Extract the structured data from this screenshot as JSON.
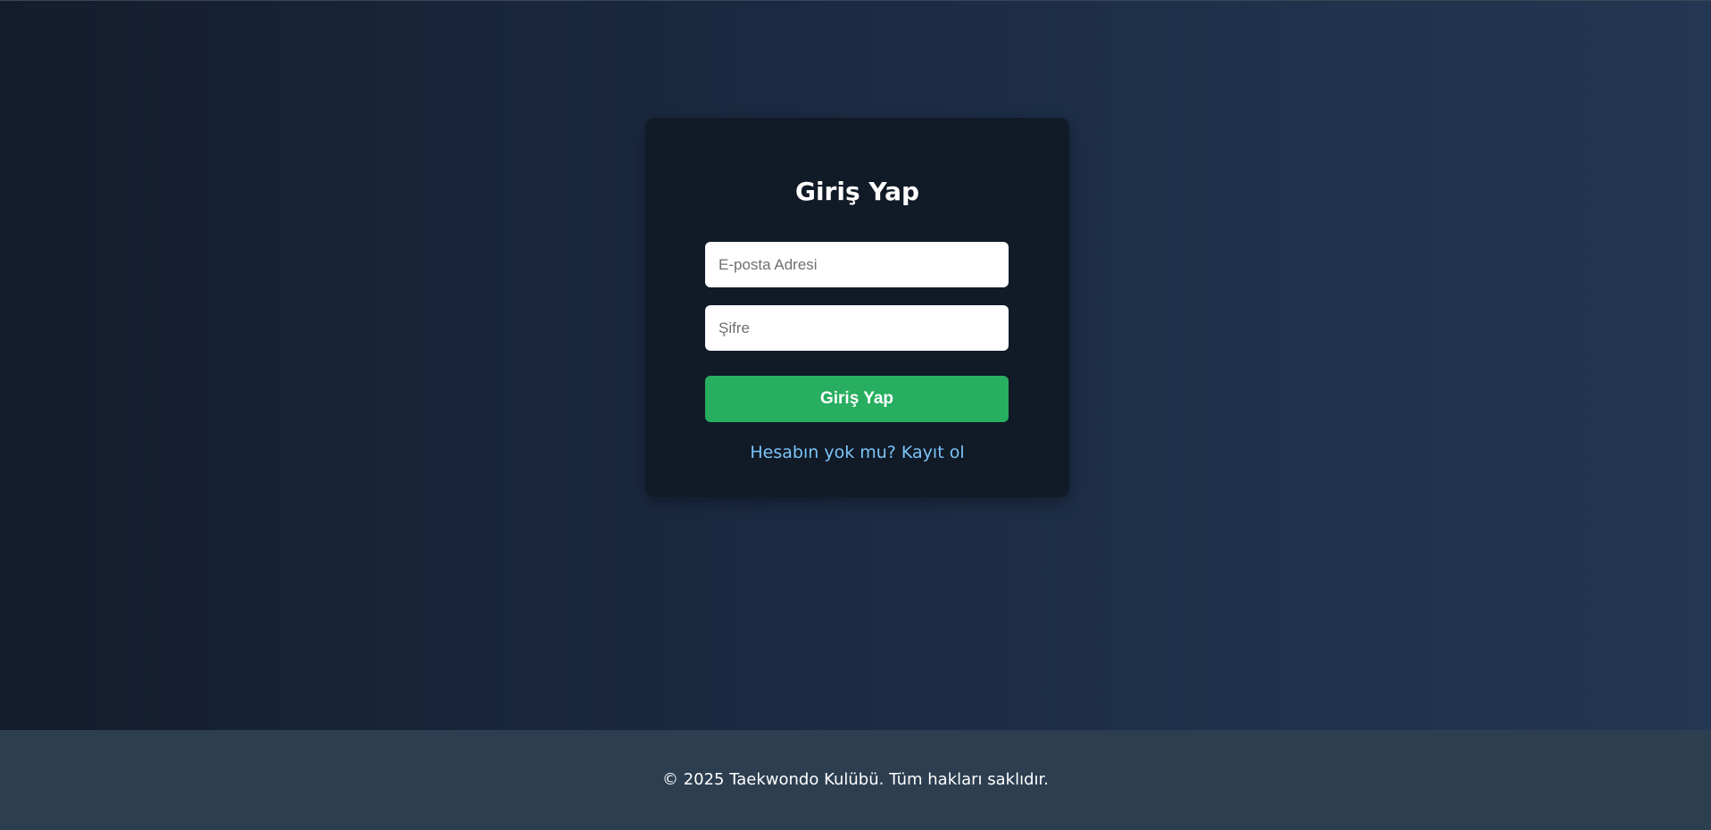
{
  "login": {
    "title": "Giriş Yap",
    "email_placeholder": "E-posta Adresi",
    "email_value": "",
    "password_placeholder": "Şifre",
    "password_value": "",
    "submit_label": "Giriş Yap",
    "register_link_text": "Hesabın yok mu? Kayıt ol"
  },
  "footer": {
    "copyright": "© 2025 Taekwondo Kulübü. Tüm hakları saklıdır."
  },
  "colors": {
    "background_start": "#141d2d",
    "background_end": "#233752",
    "card_background": "#111a27",
    "accent_green": "#27ae60",
    "link_blue": "#7cc4f8",
    "footer_background": "#2c3e50"
  }
}
